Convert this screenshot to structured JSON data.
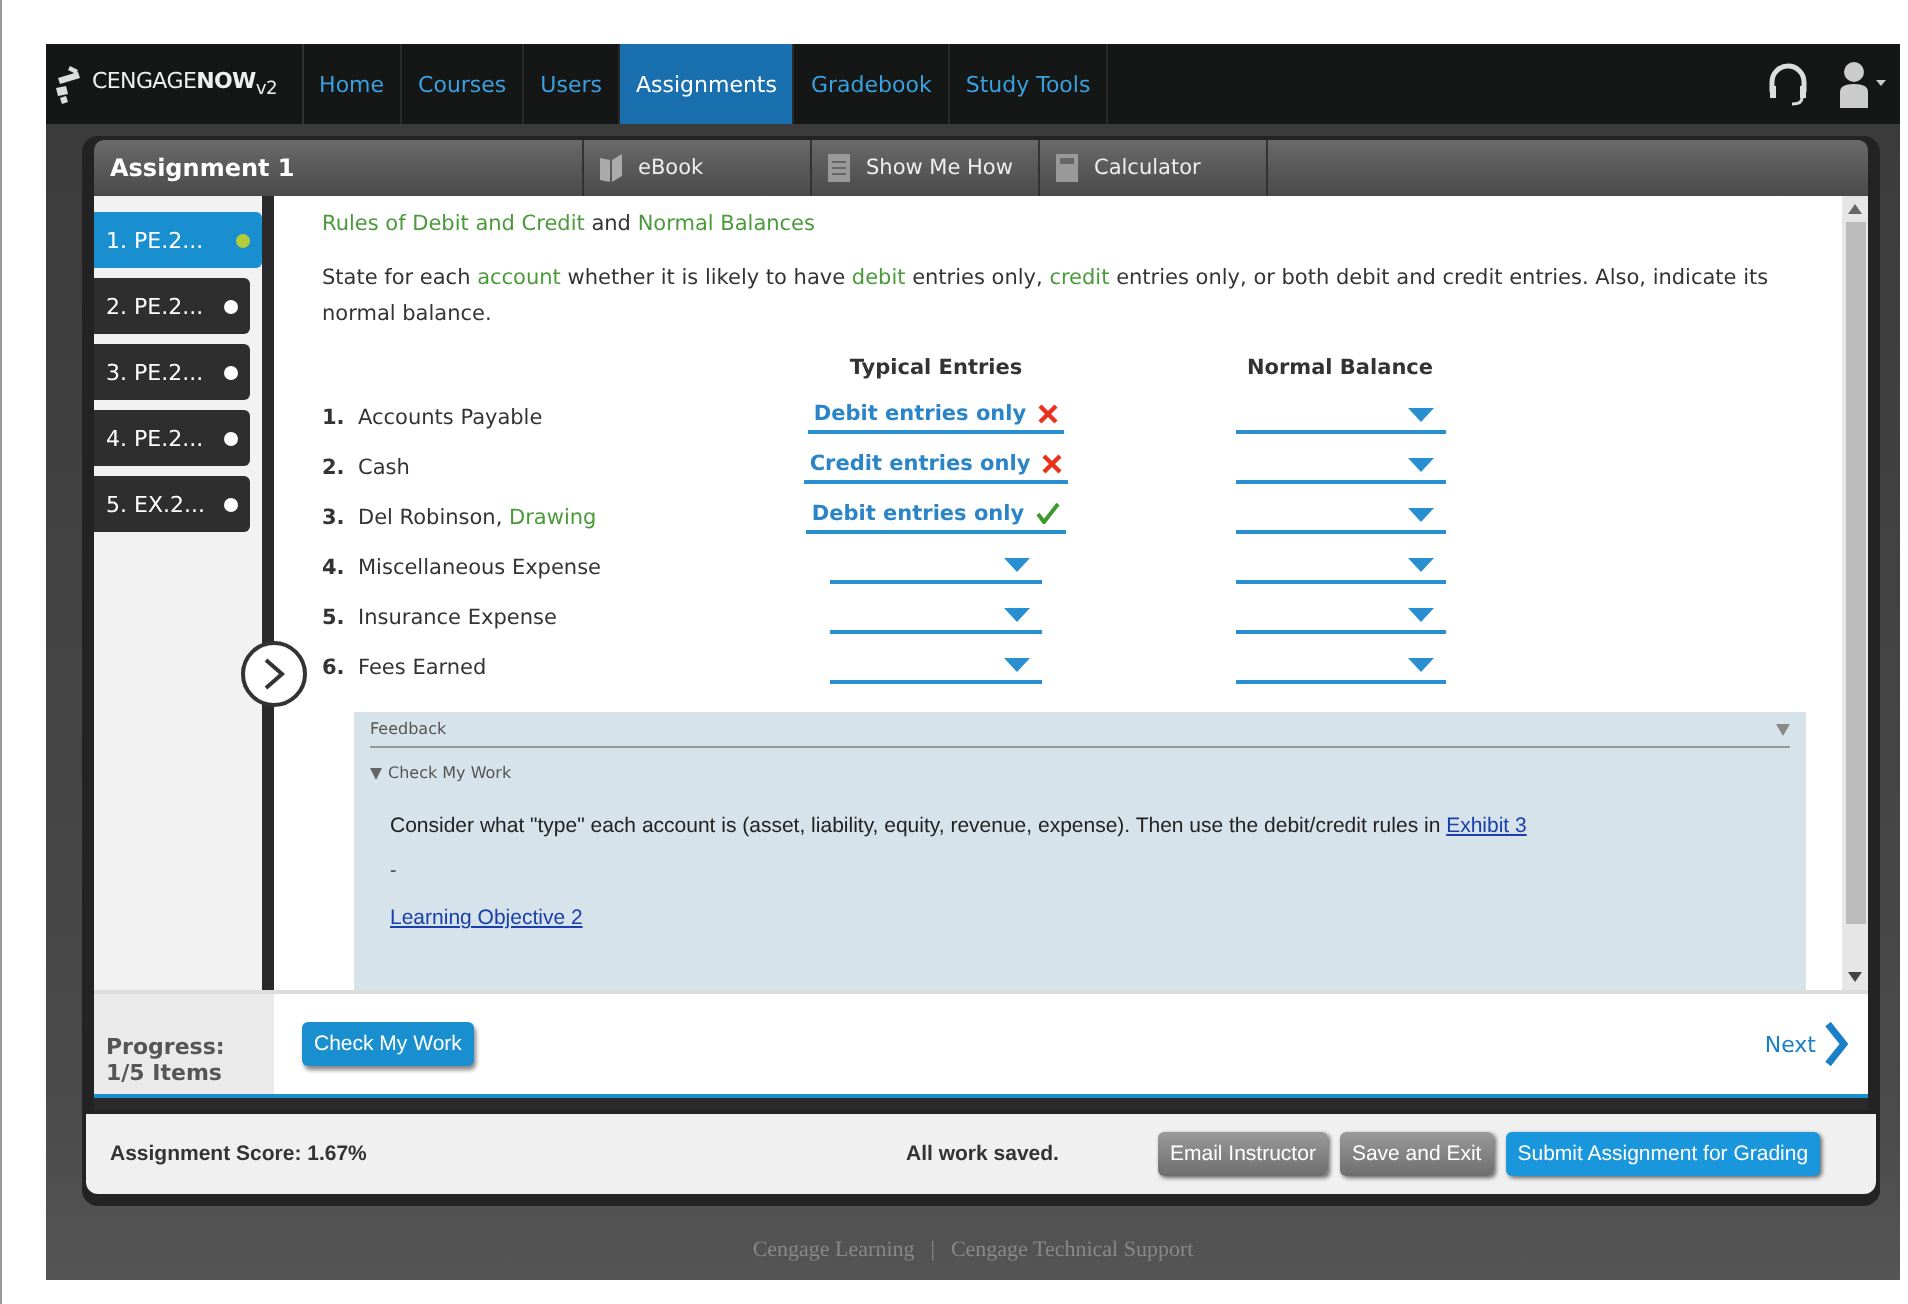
{
  "brand": "CENGAGE**NOW**$_{v2}$",
  "nav": [
    {
      "label": "Home",
      "selected": false
    },
    {
      "label": "Courses",
      "selected": false
    },
    {
      "label": "Users",
      "selected": false
    },
    {
      "label": "Assignments",
      "selected": true
    },
    {
      "label": "Gradebook",
      "selected": false
    },
    {
      "label": "Study Tools",
      "selected": false
    }
  ],
  "assignment_title": "Assignment 1",
  "tools": [
    {
      "label": "eBook",
      "kind": "book"
    },
    {
      "label": "Show Me How",
      "kind": "page"
    },
    {
      "label": "Calculator",
      "kind": "calculator"
    }
  ],
  "questions": [
    {
      "label": "1. PE.2...",
      "selected": true,
      "color": "#b5cc3a"
    },
    {
      "label": "2. PE.2...",
      "selected": false,
      "color": "#ffffff"
    },
    {
      "label": "3. PE.2...",
      "selected": false,
      "color": "#ffffff"
    },
    {
      "label": "4. PE.2...",
      "selected": false,
      "color": "#ffffff"
    },
    {
      "label": "5. EX.2...",
      "selected": false,
      "color": "#ffffff"
    }
  ],
  "title": [
    {
      "text": "Rules of Debit and Credit",
      "kind": "term"
    },
    {
      "text": " and ",
      "kind": "plain"
    },
    {
      "text": "Normal Balances",
      "kind": "term"
    }
  ],
  "instructions": [
    {
      "text": "State for each ",
      "kind": "plain"
    },
    {
      "text": "account",
      "kind": "term"
    },
    {
      "text": " whether it is likely to have ",
      "kind": "plain"
    },
    {
      "text": "debit",
      "kind": "term"
    },
    {
      "text": " entries only, ",
      "kind": "plain"
    },
    {
      "text": "credit",
      "kind": "term"
    },
    {
      "text": " entries only, or both debit and credit entries. Also, indicate its normal balance.",
      "kind": "plain"
    }
  ],
  "columns": [
    "Typical Entries",
    "Normal Balance"
  ],
  "rows": [
    {
      "number": "1.",
      "account": [
        {
          "text": "Accounts Payable",
          "kind": "plain"
        }
      ],
      "typical": {
        "value": "Debit entries only",
        "correct": false
      },
      "normal": {}
    },
    {
      "number": "2.",
      "account": [
        {
          "text": "Cash",
          "kind": "plain"
        }
      ],
      "typical": {
        "value": "Credit entries only",
        "correct": false
      },
      "normal": {}
    },
    {
      "number": "3.",
      "account": [
        {
          "text": "Del Robinson, ",
          "kind": "plain"
        },
        {
          "text": "Drawing",
          "kind": "term"
        }
      ],
      "typical": {
        "value": "Debit entries only",
        "correct": true
      },
      "normal": {}
    },
    {
      "number": "4.",
      "account": [
        {
          "text": "Miscellaneous Expense",
          "kind": "plain"
        }
      ],
      "typical": {},
      "normal": {}
    },
    {
      "number": "5.",
      "account": [
        {
          "text": "Insurance Expense",
          "kind": "plain"
        }
      ],
      "typical": {},
      "normal": {}
    },
    {
      "number": "6.",
      "account": [
        {
          "text": "Fees Earned",
          "kind": "plain"
        }
      ],
      "typical": {},
      "normal": {}
    }
  ],
  "feedback": {
    "title": "Feedback",
    "section": "Check My Work",
    "expanded": true,
    "text": "Consider what \"type\" each account is (asset, liability, equity, revenue, expense). Then use the debit/credit rules in ",
    "link": "Exhibit 3",
    "separator": "-",
    "objective_link": "Learning Objective 2"
  },
  "progress": {
    "label": "Progress:",
    "value": "1/5 Items"
  },
  "check_button": "Check My Work",
  "next_button": "Next",
  "score": "Assignment Score: 1.67%",
  "save_status": "All work saved.",
  "buttons": [
    {
      "label": "Email Instructor",
      "kind": "secondary"
    },
    {
      "label": "Save and Exit",
      "kind": "secondary"
    },
    {
      "label": "Submit Assignment for Grading",
      "kind": "primary"
    }
  ],
  "footer": [
    "Cengage Learning",
    "|",
    "Cengage Technical Support"
  ]
}
